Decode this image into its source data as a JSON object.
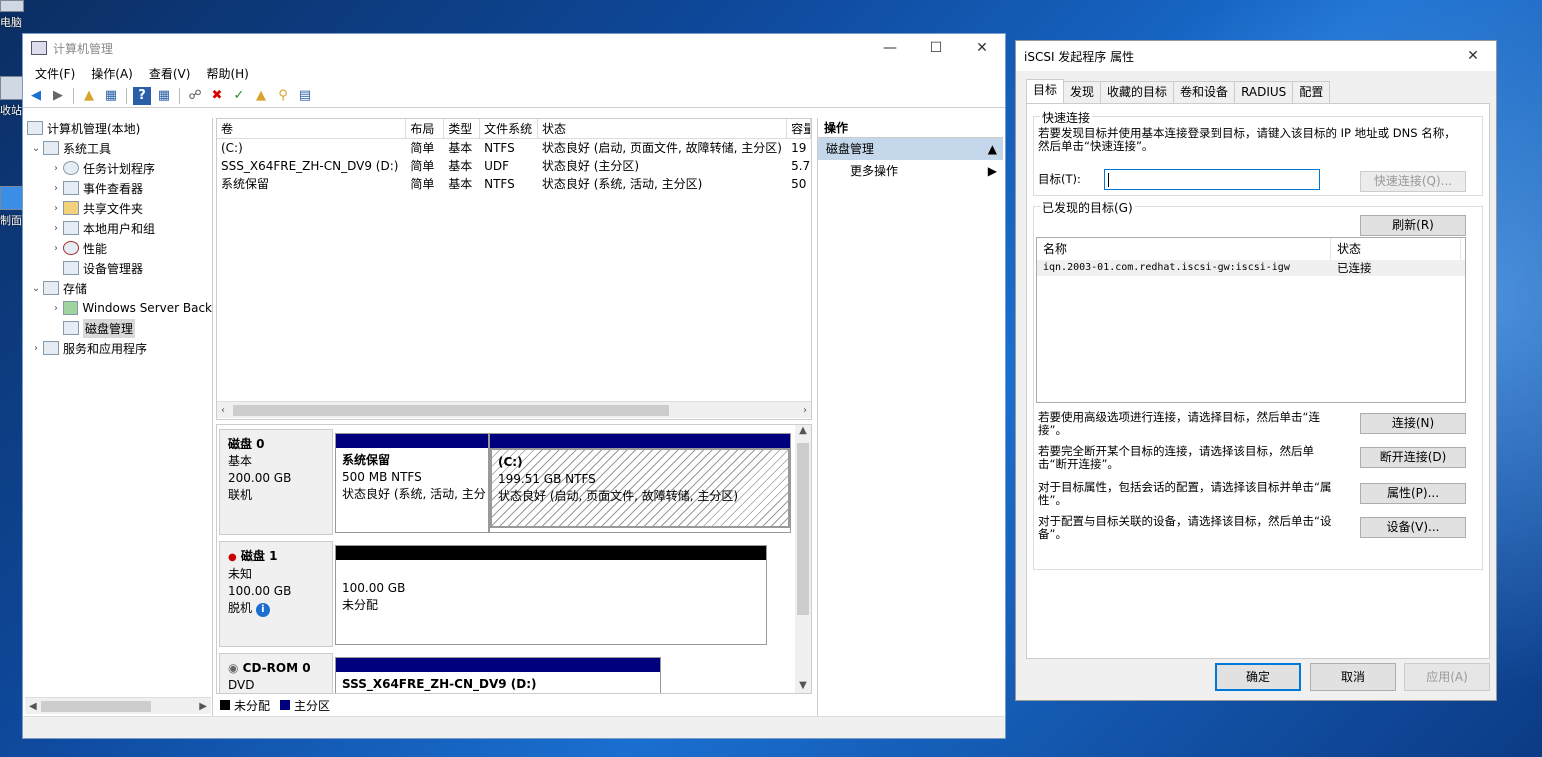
{
  "desktop": {
    "icons": [
      {
        "label": "电脑",
        "icon": "computer-icon"
      },
      {
        "label": "收站",
        "icon": "recycle-bin-icon"
      },
      {
        "label": "制面",
        "icon": "control-panel-icon"
      }
    ]
  },
  "cm": {
    "title": "计算机管理",
    "menu": [
      "文件(F)",
      "操作(A)",
      "查看(V)",
      "帮助(H)"
    ],
    "tree": [
      {
        "label": "计算机管理(本地)",
        "level": 0,
        "exp": "",
        "icon": "computer-management-icon"
      },
      {
        "label": "系统工具",
        "level": 1,
        "exp": "v",
        "icon": "tools-icon"
      },
      {
        "label": "任务计划程序",
        "level": 2,
        "exp": ">",
        "icon": "clock-icon"
      },
      {
        "label": "事件查看器",
        "level": 2,
        "exp": ">",
        "icon": "event-viewer-icon"
      },
      {
        "label": "共享文件夹",
        "level": 2,
        "exp": ">",
        "icon": "shared-folder-icon"
      },
      {
        "label": "本地用户和组",
        "level": 2,
        "exp": ">",
        "icon": "users-icon"
      },
      {
        "label": "性能",
        "level": 2,
        "exp": ">",
        "icon": "performance-icon"
      },
      {
        "label": "设备管理器",
        "level": 2,
        "exp": "",
        "icon": "device-manager-icon"
      },
      {
        "label": "存储",
        "level": 1,
        "exp": "v",
        "icon": "storage-icon"
      },
      {
        "label": "Windows Server Back",
        "level": 2,
        "exp": ">",
        "icon": "backup-icon"
      },
      {
        "label": "磁盘管理",
        "level": 2,
        "exp": "",
        "icon": "disk-management-icon",
        "selected": true
      },
      {
        "label": "服务和应用程序",
        "level": 1,
        "exp": ">",
        "icon": "services-icon"
      }
    ],
    "volumes": {
      "headers": [
        "卷",
        "布局",
        "类型",
        "文件系统",
        "状态",
        "容量"
      ],
      "rows": [
        [
          "(C:)",
          "简单",
          "基本",
          "NTFS",
          "状态良好 (启动, 页面文件, 故障转储, 主分区)",
          "19"
        ],
        [
          "SSS_X64FRE_ZH-CN_DV9 (D:)",
          "简单",
          "基本",
          "UDF",
          "状态良好 (主分区)",
          "5.7"
        ],
        [
          "系统保留",
          "简单",
          "基本",
          "NTFS",
          "状态良好 (系统, 活动, 主分区)",
          "50"
        ]
      ]
    },
    "disks": [
      {
        "name": "磁盘 0",
        "type": "基本",
        "size": "200.00 GB",
        "state": "联机",
        "parts": [
          {
            "title": "系统保留",
            "size": "500 MB NTFS",
            "status": "状态良好 (系统, 活动, 主分"
          },
          {
            "title": "(C:)",
            "size": "199.51 GB NTFS",
            "status": "状态良好 (启动, 页面文件, 故障转储, 主分区)"
          }
        ]
      },
      {
        "name": "磁盘 1",
        "type": "未知",
        "size": "100.00 GB",
        "state": "脱机",
        "parts": [
          {
            "title": "",
            "size": "100.00 GB",
            "status": "未分配"
          }
        ]
      },
      {
        "name": "CD-ROM 0",
        "type": "DVD",
        "size": "",
        "state": "",
        "parts": [
          {
            "title": "SSS_X64FRE_ZH-CN_DV9 (D:)",
            "size": "",
            "status": ""
          }
        ]
      }
    ],
    "legend": [
      "未分配",
      "主分区"
    ],
    "actions": {
      "header": "操作",
      "section": "磁盘管理",
      "item": "更多操作"
    },
    "colors": {
      "primary_partition": "#00007f",
      "unallocated": "#000000",
      "selected_section": "#c5d7ea"
    }
  },
  "dlg": {
    "title": "iSCSI 发起程序 属性",
    "tabs": [
      "目标",
      "发现",
      "收藏的目标",
      "卷和设备",
      "RADIUS",
      "配置"
    ],
    "quick": {
      "group": "快速连接",
      "desc": "若要发现目标并使用基本连接登录到目标，请键入该目标的 IP 地址或 DNS 名称，然后单击“快速连接”。",
      "target_label": "目标(T):",
      "target_value": "",
      "button": "快速连接(Q)..."
    },
    "discovered": {
      "group": "已发现的目标(G)",
      "refresh": "刷新(R)",
      "headers": [
        "名称",
        "状态"
      ],
      "rows": [
        [
          "iqn.2003-01.com.redhat.iscsi-gw:iscsi-igw",
          "已连接"
        ]
      ]
    },
    "actions": [
      {
        "text": "若要使用高级选项进行连接，请选择目标，然后单击“连接”。",
        "button": "连接(N)"
      },
      {
        "text": "若要完全断开某个目标的连接，请选择该目标，然后单击“断开连接”。",
        "button": "断开连接(D)"
      },
      {
        "text": "对于目标属性，包括会话的配置，请选择该目标并单击“属性”。",
        "button": "属性(P)..."
      },
      {
        "text": "对于配置与目标关联的设备，请选择该目标，然后单击“设备”。",
        "button": "设备(V)..."
      }
    ],
    "footer": {
      "ok": "确定",
      "cancel": "取消",
      "apply": "应用(A)"
    }
  }
}
